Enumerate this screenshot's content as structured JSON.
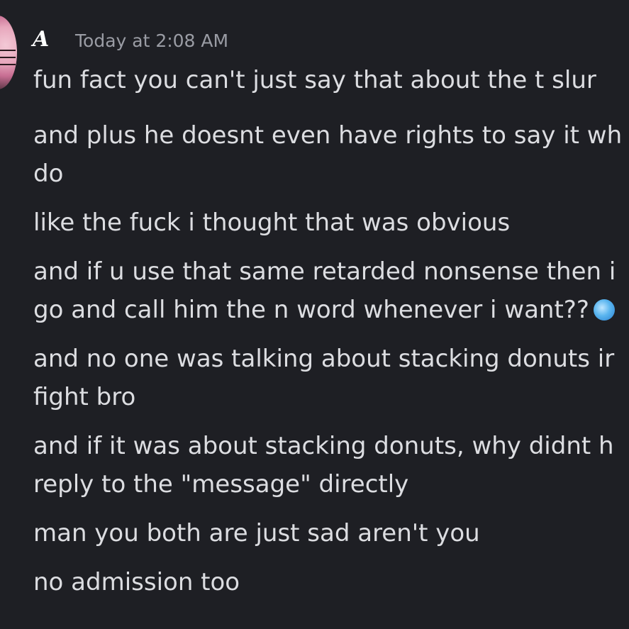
{
  "message": {
    "author": "A",
    "timestamp": "Today at 2:08 AM",
    "lines": [
      "fun fact you can't just say that about the t slur",
      "and plus he doesnt even have rights to say it wh",
      "do",
      "like the fuck i thought that was obvious",
      "and if u use that same retarded nonsense then i",
      "go and call him the n word whenever i want??",
      "and no one was talking about stacking donuts ir",
      "fight bro",
      "and if it was about stacking donuts, why didnt h",
      "reply to the \"message\" directly",
      "man you both are just sad aren't you",
      "no admission too"
    ],
    "emoji": "globe-emoji-icon"
  }
}
